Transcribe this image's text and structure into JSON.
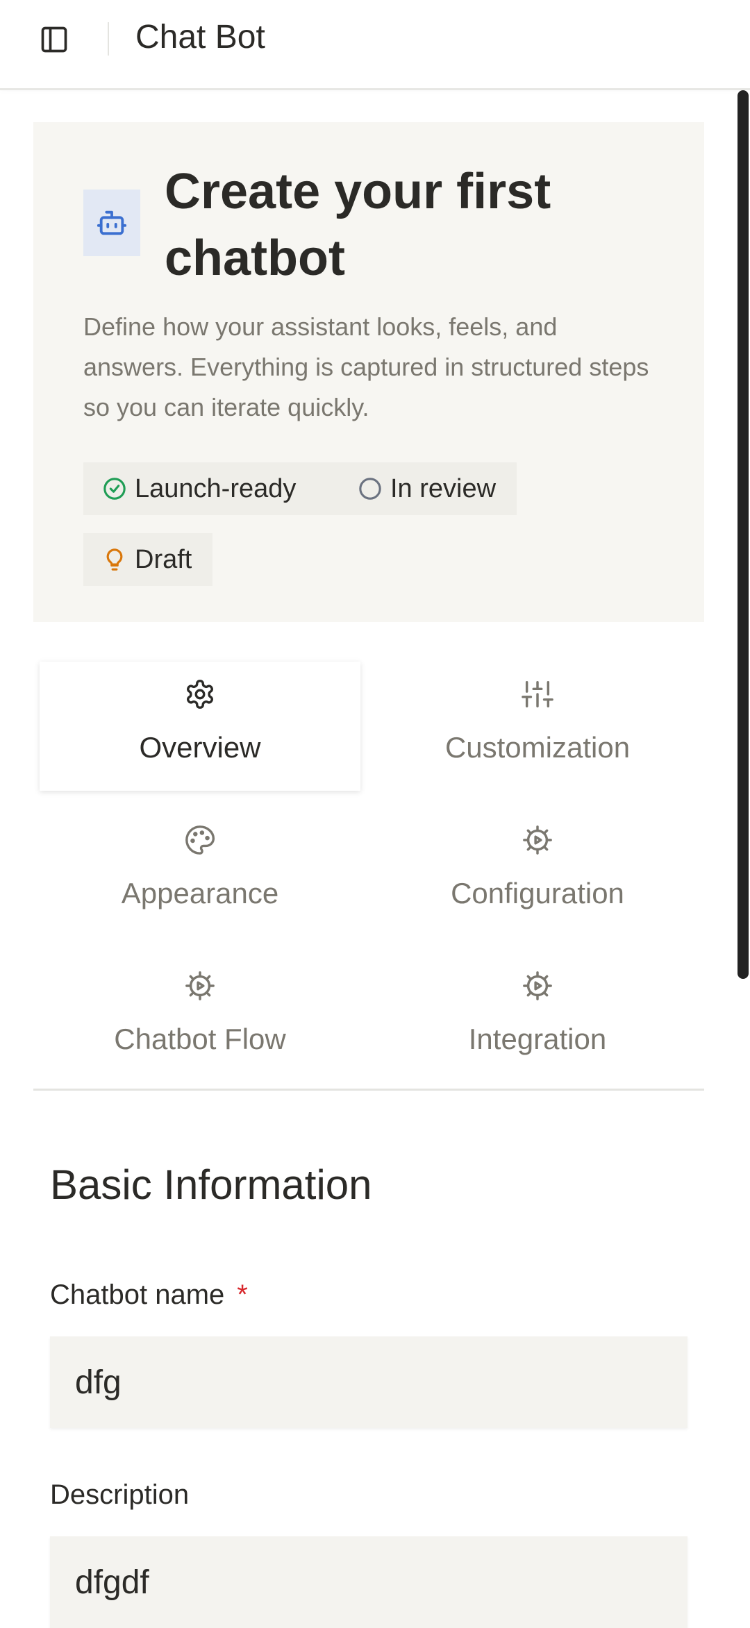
{
  "header": {
    "title": "Chat Bot",
    "sidebar_icon": "sidebar-toggle-icon"
  },
  "hero": {
    "icon": "bot-icon",
    "title": "Create your first chatbot",
    "description": "Define how your assistant looks, feels, and answers. Everything is captured in structured steps so you can iterate quickly.",
    "chips": [
      {
        "label": "Launch-ready",
        "icon": "check-circle-icon",
        "color": "#1f9d55"
      },
      {
        "label": "In review",
        "icon": "circle-icon",
        "color": "#6b7280"
      },
      {
        "label": "Draft",
        "icon": "lightbulb-icon",
        "color": "#d9770b"
      }
    ]
  },
  "tabs": [
    {
      "label": "Overview",
      "icon": "gear-icon",
      "active": true
    },
    {
      "label": "Customization",
      "icon": "sliders-icon",
      "active": false
    },
    {
      "label": "Appearance",
      "icon": "palette-icon",
      "active": false
    },
    {
      "label": "Configuration",
      "icon": "play-gear-icon",
      "active": false
    },
    {
      "label": "Chatbot Flow",
      "icon": "play-gear-icon",
      "active": false
    },
    {
      "label": "Integration",
      "icon": "play-gear-icon",
      "active": false
    }
  ],
  "form": {
    "section_title": "Basic Information",
    "fields": [
      {
        "label": "Chatbot name",
        "required_marker": "*",
        "value": "dfg"
      },
      {
        "label": "Description",
        "value": "dfgdf"
      }
    ]
  },
  "colors": {
    "accent_blue": "#3b6fd0",
    "hero_bg": "#f7f6f2",
    "required": "#d7262b"
  }
}
